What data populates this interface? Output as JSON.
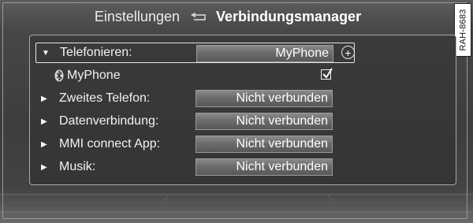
{
  "header": {
    "breadcrumb": "Einstellungen",
    "title": "Verbindungsmanager"
  },
  "side_code": "RAH-8683",
  "menu": {
    "items": [
      {
        "label": "Telefonieren:",
        "value": "MyPhone",
        "expanded": true
      },
      {
        "label": "Zweites Telefon:",
        "value": "Nicht verbunden",
        "expanded": false
      },
      {
        "label": "Datenverbindung:",
        "value": "Nicht verbunden",
        "expanded": false
      },
      {
        "label": "MMI connect App:",
        "value": "Nicht verbunden",
        "expanded": false
      },
      {
        "label": "Musik:",
        "value": "Nicht verbunden",
        "expanded": false
      }
    ],
    "device": {
      "name": "MyPhone",
      "checked": true
    },
    "plus_symbol": "+"
  },
  "colors": {
    "background": "#424242",
    "field": "#6e6e6e",
    "text": "#f2f2f2",
    "border": "#a8a8a8"
  },
  "icons": [
    "back-arrow-icon",
    "expand-triangle-icon",
    "collapsed-triangle-icon",
    "bluetooth-icon",
    "checkmark-icon",
    "plus-icon"
  ]
}
